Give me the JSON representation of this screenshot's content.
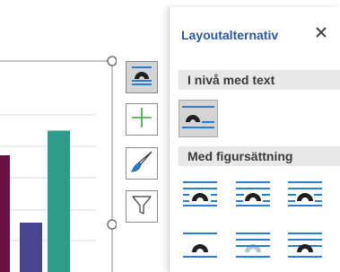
{
  "panel": {
    "title": "Layoutalternativ",
    "close_icon": "close-icon",
    "section_inline": "I nivå med text",
    "section_wrap": "Med figursättning"
  },
  "inline_options": [
    {
      "icon": "wrap-inline-icon",
      "selected": true
    }
  ],
  "wrap_options": [
    {
      "icon": "wrap-square-icon"
    },
    {
      "icon": "wrap-tight-icon"
    },
    {
      "icon": "wrap-through-icon"
    },
    {
      "icon": "wrap-top-bottom-icon"
    },
    {
      "icon": "wrap-behind-text-icon"
    },
    {
      "icon": "wrap-in-front-icon"
    }
  ],
  "toolbar": [
    {
      "icon": "layout-options-icon",
      "active": true
    },
    {
      "icon": "chart-elements-icon",
      "active": false
    },
    {
      "icon": "chart-styles-icon",
      "active": false
    },
    {
      "icon": "chart-filters-icon",
      "active": false
    }
  ],
  "colors": {
    "accent_blue": "#2b579a",
    "bar_maroon": "#6b1043",
    "bar_purple": "#4a4590",
    "bar_teal": "#2e9c8a",
    "plus_green": "#3aa53a"
  },
  "chart_data": {
    "type": "bar",
    "categories": [
      "",
      "",
      ""
    ],
    "values": [
      0.52,
      0.22,
      0.63
    ],
    "series_colors": [
      "#6b1043",
      "#4a4590",
      "#2e9c8a"
    ],
    "grid": true
  }
}
